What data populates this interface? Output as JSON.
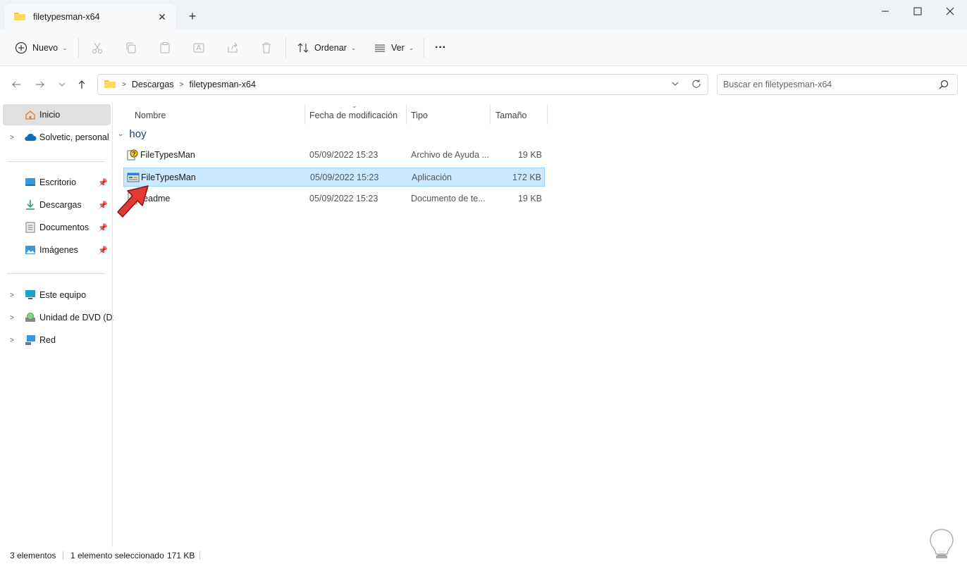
{
  "window": {
    "tab_title": "filetypesman-x64",
    "close_tab": "✕",
    "new_tab": "+"
  },
  "toolbar": {
    "new_label": "Nuevo",
    "sort_label": "Ordenar",
    "view_label": "Ver",
    "more_label": "···"
  },
  "address": {
    "crumbs": [
      "Descargas",
      "filetypesman-x64"
    ]
  },
  "search": {
    "placeholder": "Buscar en filetypesman-x64"
  },
  "sidebar": {
    "items": [
      {
        "label": "Inicio",
        "icon": "home-icon"
      },
      {
        "label": "Solvetic, personal",
        "icon": "cloud-icon"
      },
      {
        "label": "Escritorio",
        "icon": "desktop-icon"
      },
      {
        "label": "Descargas",
        "icon": "download-icon"
      },
      {
        "label": "Documentos",
        "icon": "documents-icon"
      },
      {
        "label": "Imágenes",
        "icon": "pictures-icon"
      },
      {
        "label": "Este equipo",
        "icon": "computer-icon"
      },
      {
        "label": "Unidad de DVD (D:)",
        "icon": "dvd-drive-icon"
      },
      {
        "label": "Red",
        "icon": "network-icon"
      }
    ]
  },
  "columns": {
    "name": "Nombre",
    "date": "Fecha de modificación",
    "type": "Tipo",
    "size": "Tamaño"
  },
  "group": {
    "label": "hoy"
  },
  "files": [
    {
      "name": "FileTypesMan",
      "date": "05/09/2022 15:23",
      "type": "Archivo de Ayuda ...",
      "size": "19 KB",
      "icon": "help-file-icon",
      "selected": false
    },
    {
      "name": "FileTypesMan",
      "date": "05/09/2022 15:23",
      "type": "Aplicación",
      "size": "172 KB",
      "icon": "application-icon",
      "selected": true
    },
    {
      "name": "readme",
      "date": "05/09/2022 15:23",
      "type": "Documento de te...",
      "size": "19 KB",
      "icon": "text-document-icon",
      "selected": false
    }
  ],
  "status": {
    "count": "3 elementos",
    "selection": "1 elemento seleccionado",
    "selection_size": "171 KB"
  },
  "colors": {
    "accent": "#0067c0",
    "selection_bg": "#cce8ff",
    "selection_border": "#99d1ff",
    "folder": "#f6c344",
    "arrow": "#e53935"
  }
}
